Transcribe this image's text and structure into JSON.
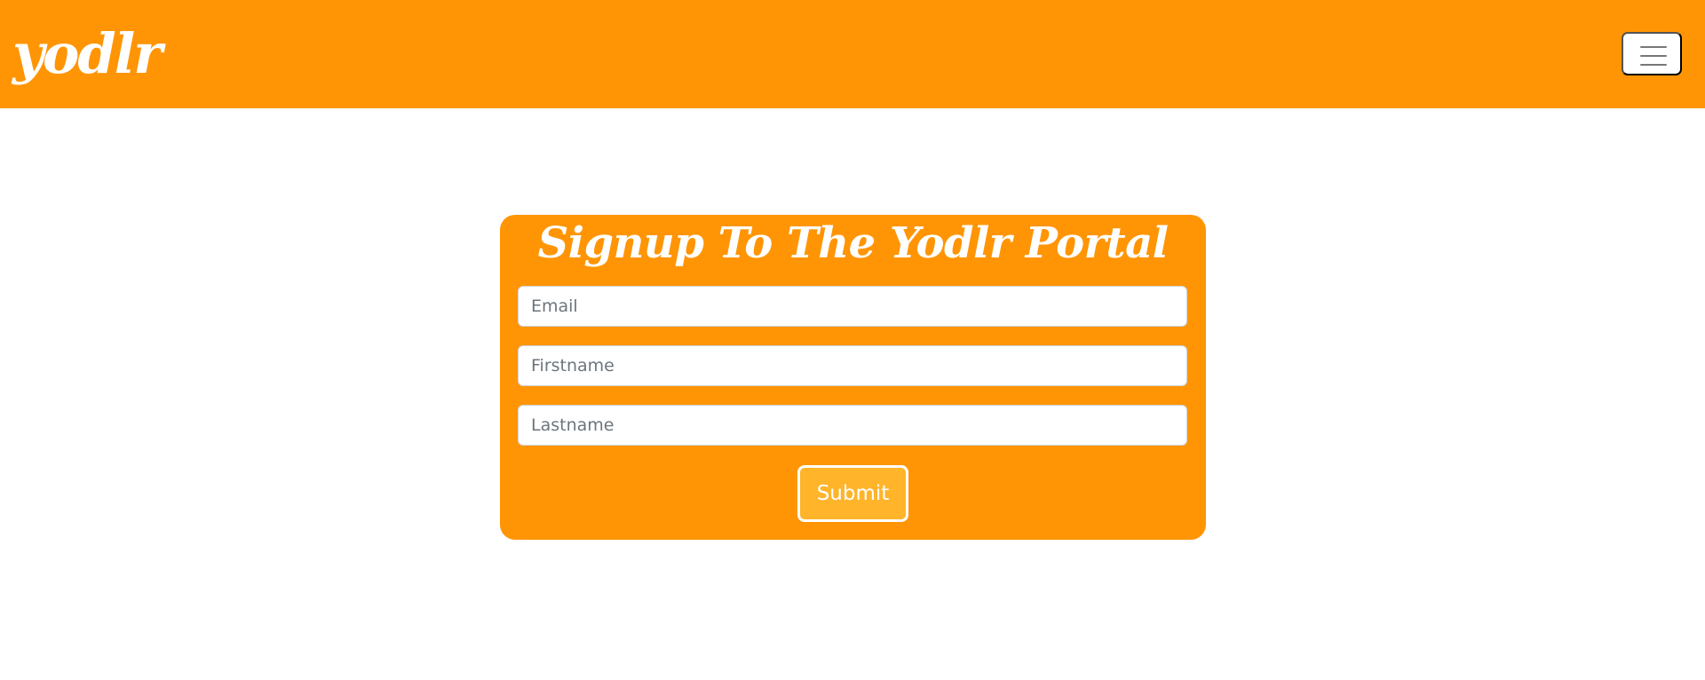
{
  "navbar": {
    "brand": "yodlr",
    "menu_icon": "hamburger-menu-icon"
  },
  "signup": {
    "title": "Signup To The Yodlr Portal",
    "fields": {
      "email_placeholder": "Email",
      "email_value": "",
      "firstname_placeholder": "Firstname",
      "firstname_value": "",
      "lastname_placeholder": "Lastname",
      "lastname_value": ""
    },
    "submit_label": "Submit"
  },
  "colors": {
    "brand_orange": "#ff9505",
    "submit_fill": "#ffb42a",
    "text_on_brand": "#ffffff"
  }
}
